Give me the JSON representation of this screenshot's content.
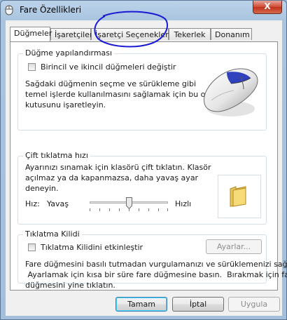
{
  "window": {
    "title": "Fare Özellikleri",
    "close_symbol": "X",
    "icon": "mouse-app-icon"
  },
  "tabs": [
    {
      "label": "Düğmeler",
      "active": true
    },
    {
      "label": "İşaretçiler",
      "active": false
    },
    {
      "label": "İşaretçi Seçenekleri",
      "active": false
    },
    {
      "label": "Tekerlek",
      "active": false
    },
    {
      "label": "Donanım",
      "active": false
    }
  ],
  "button_config": {
    "title": "Düğme yapılandırması",
    "checkbox_label": "Birincil ve ikincil düğmeleri değiştir",
    "checked": false,
    "description": [
      "Sağdaki düğmenin seçme ve sürükleme gibi",
      "temel işlerde kullanılmasını sağlamak için bu onay",
      "kutusunu işaretleyin."
    ],
    "image": "mouse-illustration"
  },
  "double_click": {
    "title": "Çift tıklatma hızı",
    "description": [
      "Ayarınızı sınamak için klasörü çift tıklatın. Klasör",
      "açılmaz ya da kapanmazsa, daha yavaş ayar",
      "deneyin."
    ],
    "speed_label": "Hız:",
    "slow_label": "Yavaş",
    "fast_label": "Hızlı",
    "speed_value": 0.5,
    "test_icon": "folder-icon"
  },
  "click_lock": {
    "title": "Tıklatma Kilidi",
    "checkbox_label": "Tıklatma Kilidini etkinleştir",
    "checked": false,
    "settings_button": "Ayarlar...",
    "description": [
      "Fare düğmesini basılı tutmadan vurgulamanızı ve sürüklemenizi sağlar.",
      " Ayarlamak için kısa bir süre fare düğmesine basın.  Bırakmak için fare",
      "düğmesini yine tıklatın."
    ]
  },
  "footer": {
    "ok": "Tamam",
    "cancel": "İptal",
    "apply": "Uygula"
  },
  "colors": {
    "annotation": "#1a1ad6",
    "default_button_border": "#3c7fb1"
  }
}
